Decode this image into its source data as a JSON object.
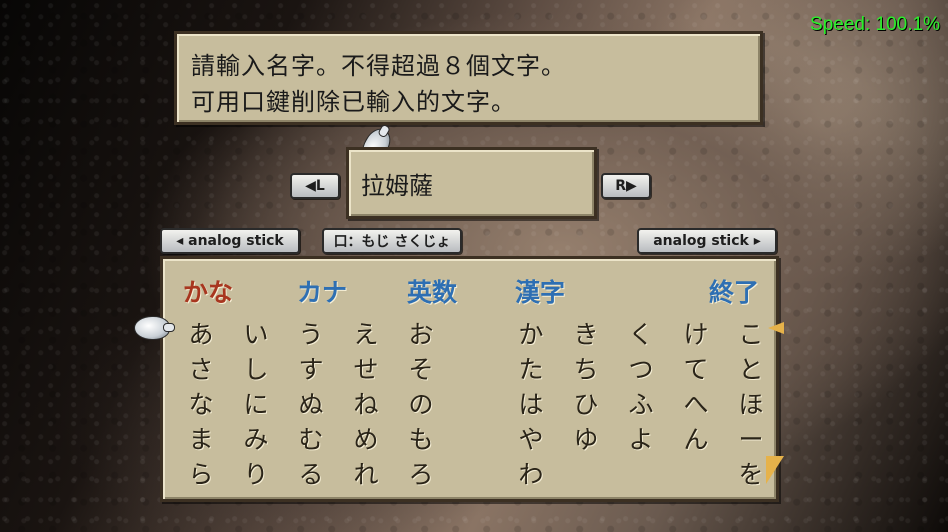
{
  "emulator": {
    "speed": "Speed: 100.1%"
  },
  "message": {
    "line1": "請輸入名字。不得超過８個文字。",
    "line2": "可用口鍵削除已輸入的文字。"
  },
  "name_entry": {
    "value": "拉姆薩"
  },
  "buttons": {
    "l": "◀L",
    "r": "R▶",
    "analog_left": "◂ analog stick",
    "dict": "口：もじ さくじょ",
    "analog_right": "analog stick ▸"
  },
  "categories": [
    {
      "label": "かな",
      "color": "#a8361f"
    },
    {
      "label": "カナ",
      "color": "#2e6fb3"
    },
    {
      "label": "英数",
      "color": "#2e6fb3"
    },
    {
      "label": "漢字",
      "color": "#2e6fb3"
    },
    {
      "label": "終了",
      "color": "#2e6fb3"
    }
  ],
  "kana_rows": [
    [
      "あ",
      "い",
      "う",
      "え",
      "お",
      "か",
      "き",
      "く",
      "け",
      "こ"
    ],
    [
      "さ",
      "し",
      "す",
      "せ",
      "そ",
      "た",
      "ち",
      "つ",
      "て",
      "と"
    ],
    [
      "な",
      "に",
      "ぬ",
      "ね",
      "の",
      "は",
      "ひ",
      "ふ",
      "へ",
      "ほ"
    ],
    [
      "ま",
      "み",
      "む",
      "め",
      "も",
      "や",
      "ゆ",
      "よ",
      "ん",
      "ー"
    ],
    [
      "ら",
      "り",
      "る",
      "れ",
      "ろ",
      "わ",
      "",
      "",
      "",
      "を"
    ]
  ],
  "colors": {
    "panel": "#c7bd9d",
    "speed": "#2bf02b",
    "kana_tab": "#a8361f",
    "tab": "#2e6fb3"
  }
}
